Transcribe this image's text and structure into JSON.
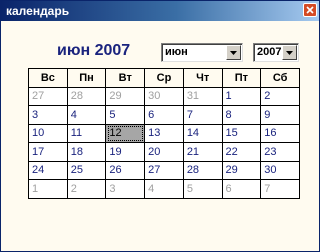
{
  "window": {
    "title": "календарь"
  },
  "header": {
    "month_title": "июн 2007",
    "month_select": {
      "value": "июн"
    },
    "year_select": {
      "value": "2007"
    }
  },
  "calendar": {
    "weekdays": [
      "Вс",
      "Пн",
      "Вт",
      "Ср",
      "Чт",
      "Пт",
      "Сб"
    ],
    "weeks": [
      [
        {
          "d": "27",
          "o": true
        },
        {
          "d": "28",
          "o": true
        },
        {
          "d": "29",
          "o": true
        },
        {
          "d": "30",
          "o": true
        },
        {
          "d": "31",
          "o": true
        },
        {
          "d": "1",
          "o": false
        },
        {
          "d": "2",
          "o": false
        }
      ],
      [
        {
          "d": "3",
          "o": false
        },
        {
          "d": "4",
          "o": false
        },
        {
          "d": "5",
          "o": false
        },
        {
          "d": "6",
          "o": false
        },
        {
          "d": "7",
          "o": false
        },
        {
          "d": "8",
          "o": false
        },
        {
          "d": "9",
          "o": false
        }
      ],
      [
        {
          "d": "10",
          "o": false
        },
        {
          "d": "11",
          "o": false
        },
        {
          "d": "12",
          "o": false,
          "selected": true
        },
        {
          "d": "13",
          "o": false
        },
        {
          "d": "14",
          "o": false
        },
        {
          "d": "15",
          "o": false
        },
        {
          "d": "16",
          "o": false
        }
      ],
      [
        {
          "d": "17",
          "o": false
        },
        {
          "d": "18",
          "o": false
        },
        {
          "d": "19",
          "o": false
        },
        {
          "d": "20",
          "o": false
        },
        {
          "d": "21",
          "o": false
        },
        {
          "d": "22",
          "o": false
        },
        {
          "d": "23",
          "o": false
        }
      ],
      [
        {
          "d": "24",
          "o": false
        },
        {
          "d": "25",
          "o": false
        },
        {
          "d": "26",
          "o": false
        },
        {
          "d": "27",
          "o": false
        },
        {
          "d": "28",
          "o": false
        },
        {
          "d": "29",
          "o": false
        },
        {
          "d": "30",
          "o": false
        }
      ],
      [
        {
          "d": "1",
          "o": true
        },
        {
          "d": "2",
          "o": true
        },
        {
          "d": "3",
          "o": true
        },
        {
          "d": "4",
          "o": true
        },
        {
          "d": "5",
          "o": true
        },
        {
          "d": "6",
          "o": true
        },
        {
          "d": "7",
          "o": true
        }
      ]
    ]
  },
  "colors": {
    "title_bar": "#0a246a",
    "month_title": "#1a237e",
    "day_current_month": "#1a237e",
    "day_other_month": "#a0a0a0",
    "selected_day_bg": "#a6a6a6",
    "close_button": "#d44a24"
  },
  "icons": {
    "close": "close-icon",
    "dropdown": "chevron-down-icon"
  }
}
